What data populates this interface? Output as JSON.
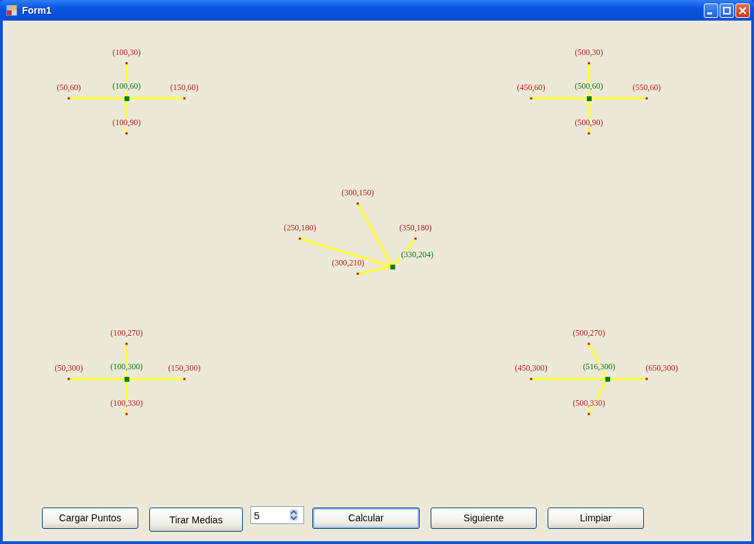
{
  "window": {
    "title": "Form1"
  },
  "clusters": [
    {
      "center": "(100,60)",
      "points": [
        "(100,30)",
        "(50,60)",
        "(150,60)",
        "(100,90)"
      ]
    },
    {
      "center": "(500,60)",
      "points": [
        "(500,30)",
        "(450,60)",
        "(550,60)",
        "(500,90)"
      ]
    },
    {
      "center": "(330,204)",
      "points": [
        "(300,150)",
        "(250,180)",
        "(350,180)",
        "(300,210)"
      ]
    },
    {
      "center": "(100,300)",
      "points": [
        "(100,270)",
        "(50,300)",
        "(150,300)",
        "(100,330)"
      ]
    },
    {
      "center": "(516,300)",
      "points": [
        "(500,270)",
        "(450,300)",
        "(650,300)",
        "(500,330)"
      ]
    }
  ],
  "controls": [
    {
      "kind": "button",
      "label": "Cargar Puntos",
      "focused": false
    },
    {
      "kind": "button",
      "label": "Tirar Medias",
      "focused": false
    },
    {
      "kind": "spinner",
      "value": "5"
    },
    {
      "kind": "button",
      "label": "Calcular",
      "focused": true
    },
    {
      "kind": "button",
      "label": "Siguiente",
      "focused": false
    },
    {
      "kind": "button",
      "label": "Limpiar",
      "focused": false
    }
  ]
}
